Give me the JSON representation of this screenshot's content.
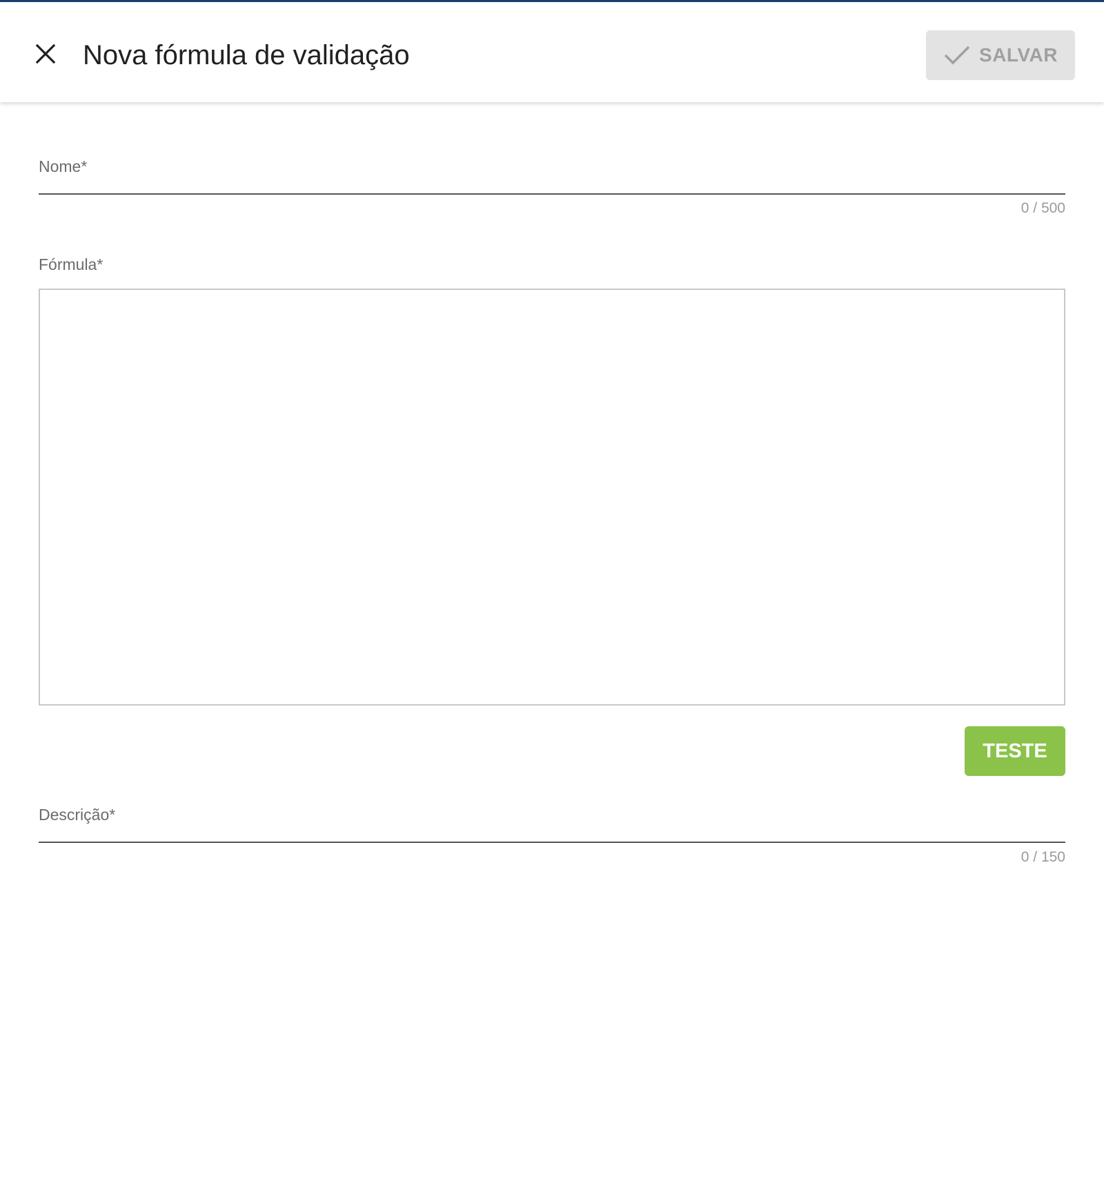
{
  "header": {
    "title": "Nova fórmula de validação",
    "close_icon": "close-icon",
    "save_label": "SALVAR",
    "save_icon": "check-icon",
    "save_enabled": false
  },
  "form": {
    "name": {
      "label": "Nome*",
      "value": "",
      "counter": "0 / 500"
    },
    "formula": {
      "label": "Fórmula*",
      "value": ""
    },
    "test_label": "TESTE",
    "description": {
      "label": "Descrição*",
      "value": "",
      "counter": "0 / 150"
    }
  },
  "colors": {
    "accent_green": "#8bc34a",
    "disabled_bg": "#e3e3e3",
    "disabled_text": "#a0a0a0",
    "top_accent": "#1b3f6b"
  }
}
